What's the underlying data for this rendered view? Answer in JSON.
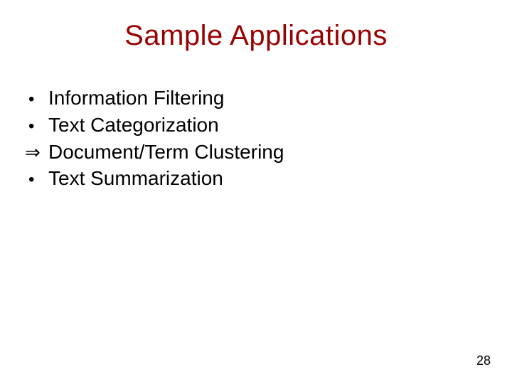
{
  "title": "Sample Applications",
  "items": [
    {
      "bullet": "dot",
      "text": "Information Filtering"
    },
    {
      "bullet": "dot",
      "text": "Text Categorization"
    },
    {
      "bullet": "arrow",
      "text": "Document/Term Clustering"
    },
    {
      "bullet": "dot",
      "text": "Text Summarization"
    }
  ],
  "page_number": "28"
}
